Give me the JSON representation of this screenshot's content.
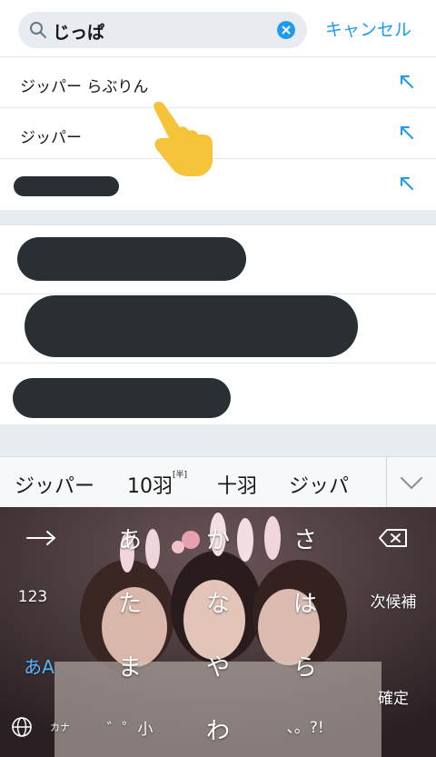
{
  "search": {
    "query": "じっぱ",
    "cancel_label": "キャンセル"
  },
  "suggestions": [
    {
      "label": "ジッパー らぶりん"
    },
    {
      "label": "ジッパー"
    },
    {
      "label": ""
    }
  ],
  "candidates": {
    "items": [
      "ジッパー",
      "10羽",
      "十羽",
      "ジッパ"
    ],
    "superscript": "[半]"
  },
  "keyboard": {
    "row1": [
      "あ",
      "か",
      "さ"
    ],
    "row2": [
      "た",
      "な",
      "は"
    ],
    "row3": [
      "ま",
      "や",
      "ら"
    ],
    "row4": [
      "゛゜小",
      "わ",
      "、。?!"
    ],
    "left_keys": [
      "123",
      "あA"
    ],
    "lang_label": "カナ",
    "next_candidate": "次候補",
    "confirm": "確定"
  },
  "colors": {
    "accent": "#1d9bf0",
    "redaction": "#2a2f33"
  },
  "icons": [
    "search-icon",
    "clear-icon",
    "arrow-up-left-icon",
    "chevron-down-icon",
    "arrow-right-icon",
    "backspace-icon",
    "globe-icon",
    "pointing-hand-icon"
  ]
}
